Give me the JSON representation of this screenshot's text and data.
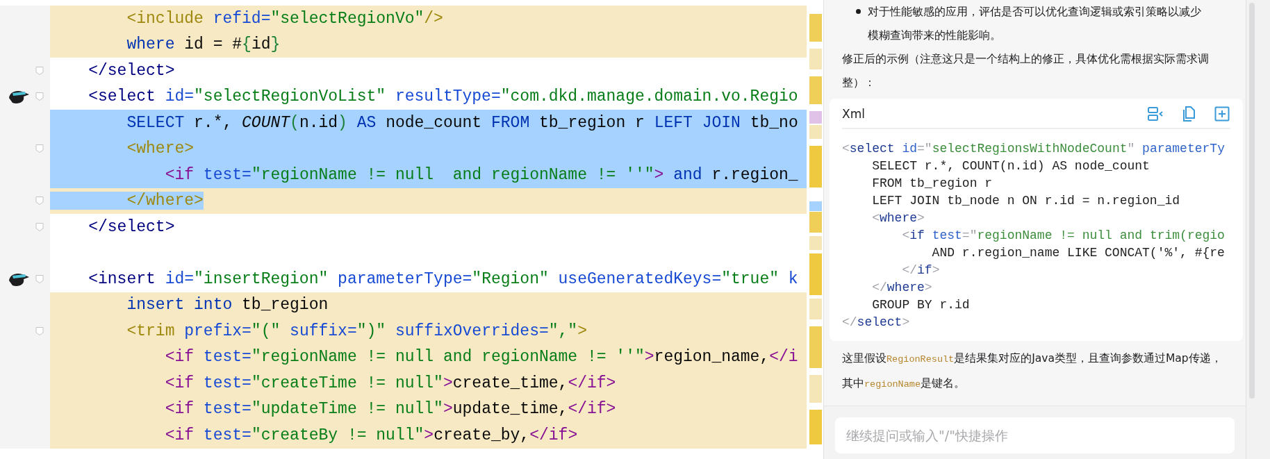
{
  "editor": {
    "lines": [
      {
        "changed": true,
        "selected": false,
        "avatar": false,
        "fold": false,
        "tokens": [
          {
            "kind": "tag-sql",
            "text": "        <include"
          },
          {
            "kind": "attr",
            "text": " refid="
          },
          {
            "kind": "str",
            "text": "\"selectRegionVo\""
          },
          {
            "kind": "tag-sql",
            "text": "/>"
          }
        ]
      },
      {
        "changed": true,
        "selected": false,
        "avatar": false,
        "fold": false,
        "tokens": [
          {
            "kind": "kw",
            "text": "        where"
          },
          {
            "kind": "text",
            "text": " id = #"
          },
          {
            "kind": "brace",
            "text": "{"
          },
          {
            "kind": "text",
            "text": "id"
          },
          {
            "kind": "brace",
            "text": "}"
          }
        ]
      },
      {
        "changed": false,
        "selected": false,
        "avatar": false,
        "fold": true,
        "tokens": [
          {
            "kind": "tag-stmt",
            "text": "    </select>"
          }
        ]
      },
      {
        "changed": false,
        "selected": false,
        "avatar": true,
        "fold": true,
        "tokens": [
          {
            "kind": "tag-stmt",
            "text": "    <select"
          },
          {
            "kind": "attr",
            "text": " id="
          },
          {
            "kind": "str",
            "text": "\"selectRegionVoList\""
          },
          {
            "kind": "attr",
            "text": " resultType="
          },
          {
            "kind": "str",
            "text": "\"com.dkd.manage.domain.vo.Regio"
          }
        ]
      },
      {
        "changed": false,
        "selected": true,
        "avatar": false,
        "fold": false,
        "tokens": [
          {
            "kind": "kw",
            "text": "        SELECT"
          },
          {
            "kind": "text",
            "text": " r.*, "
          },
          {
            "kind": "func",
            "text": "COUNT"
          },
          {
            "kind": "brace",
            "text": "("
          },
          {
            "kind": "text",
            "text": "n.id"
          },
          {
            "kind": "brace",
            "text": ")"
          },
          {
            "kind": "kw",
            "text": " AS"
          },
          {
            "kind": "text",
            "text": " node_count "
          },
          {
            "kind": "kw",
            "text": "FROM"
          },
          {
            "kind": "text",
            "text": " tb_region r "
          },
          {
            "kind": "kw",
            "text": "LEFT JOIN"
          },
          {
            "kind": "text",
            "text": " tb_no"
          }
        ]
      },
      {
        "changed": false,
        "selected": true,
        "avatar": false,
        "fold": true,
        "tokens": [
          {
            "kind": "tag-sql",
            "text": "        <where>"
          }
        ]
      },
      {
        "changed": false,
        "selected": true,
        "avatar": false,
        "fold": false,
        "tokens": [
          {
            "kind": "tag-if",
            "text": "            <if"
          },
          {
            "kind": "attr",
            "text": " test="
          },
          {
            "kind": "str",
            "text": "\"regionName != null  and regionName != ''\""
          },
          {
            "kind": "tag-if",
            "text": ">"
          },
          {
            "kind": "kw",
            "text": " and"
          },
          {
            "kind": "text",
            "text": " r.region_"
          }
        ]
      },
      {
        "changed": true,
        "selected": true,
        "avatar": false,
        "fold": true,
        "tokens": [
          {
            "kind": "tag-sql",
            "text": "        </where>"
          }
        ]
      },
      {
        "changed": false,
        "selected": false,
        "avatar": false,
        "fold": true,
        "tokens": [
          {
            "kind": "tag-stmt",
            "text": "    </select>"
          }
        ]
      },
      {
        "changed": false,
        "selected": false,
        "avatar": false,
        "fold": false
      },
      {
        "changed": false,
        "selected": false,
        "avatar": true,
        "fold": true,
        "tokens": [
          {
            "kind": "tag-stmt",
            "text": "    <insert"
          },
          {
            "kind": "attr",
            "text": " id="
          },
          {
            "kind": "str",
            "text": "\"insertRegion\""
          },
          {
            "kind": "attr",
            "text": " parameterType="
          },
          {
            "kind": "str",
            "text": "\"Region\""
          },
          {
            "kind": "attr",
            "text": " useGeneratedKeys="
          },
          {
            "kind": "str",
            "text": "\"true\""
          },
          {
            "kind": "attr",
            "text": " k"
          }
        ]
      },
      {
        "changed": true,
        "selected": false,
        "avatar": false,
        "fold": false,
        "tokens": [
          {
            "kind": "kw",
            "text": "        insert into"
          },
          {
            "kind": "text",
            "text": " tb_region"
          }
        ]
      },
      {
        "changed": true,
        "selected": false,
        "avatar": false,
        "fold": true,
        "tokens": [
          {
            "kind": "tag-sql",
            "text": "        <trim"
          },
          {
            "kind": "attr",
            "text": " prefix="
          },
          {
            "kind": "str",
            "text": "\"(\""
          },
          {
            "kind": "attr",
            "text": " suffix="
          },
          {
            "kind": "str",
            "text": "\")\""
          },
          {
            "kind": "attr",
            "text": " suffixOverrides="
          },
          {
            "kind": "str",
            "text": "\",\""
          },
          {
            "kind": "tag-sql",
            "text": ">"
          }
        ]
      },
      {
        "changed": true,
        "selected": false,
        "avatar": false,
        "fold": false,
        "tokens": [
          {
            "kind": "tag-if",
            "text": "            <if"
          },
          {
            "kind": "attr",
            "text": " test="
          },
          {
            "kind": "str",
            "text": "\"regionName != null and regionName != ''\""
          },
          {
            "kind": "tag-if",
            "text": ">"
          },
          {
            "kind": "text",
            "text": "region_name,"
          },
          {
            "kind": "tag-if",
            "text": "</i"
          }
        ]
      },
      {
        "changed": true,
        "selected": false,
        "avatar": false,
        "fold": false,
        "tokens": [
          {
            "kind": "tag-if",
            "text": "            <if"
          },
          {
            "kind": "attr",
            "text": " test="
          },
          {
            "kind": "str",
            "text": "\"createTime != null\""
          },
          {
            "kind": "tag-if",
            "text": ">"
          },
          {
            "kind": "text",
            "text": "create_time,"
          },
          {
            "kind": "tag-if",
            "text": "</if>"
          }
        ]
      },
      {
        "changed": true,
        "selected": false,
        "avatar": false,
        "fold": false,
        "tokens": [
          {
            "kind": "tag-if",
            "text": "            <if"
          },
          {
            "kind": "attr",
            "text": " test="
          },
          {
            "kind": "str",
            "text": "\"updateTime != null\""
          },
          {
            "kind": "tag-if",
            "text": ">"
          },
          {
            "kind": "text",
            "text": "update_time,"
          },
          {
            "kind": "tag-if",
            "text": "</if>"
          }
        ]
      },
      {
        "changed": true,
        "selected": false,
        "avatar": false,
        "fold": false,
        "tokens": [
          {
            "kind": "tag-if",
            "text": "            <if"
          },
          {
            "kind": "attr",
            "text": " test="
          },
          {
            "kind": "str",
            "text": "\"createBy != null\""
          },
          {
            "kind": "tag-if",
            "text": ">"
          },
          {
            "kind": "text",
            "text": "create_by,"
          },
          {
            "kind": "tag-if",
            "text": "</if>"
          }
        ]
      }
    ]
  },
  "assistant": {
    "bullet_text": "对于性能敏感的应用，评估是否可以优化查询逻辑或索引策略以减少模糊查询带来的性能影响。",
    "intro": "修正后的示例（注意这只是一个结构上的修正，具体优化需根据实际需求调整）：",
    "code_block": {
      "language": "Xml",
      "lines": [
        [
          {
            "kind": "punct",
            "text": "<"
          },
          {
            "kind": "tag",
            "text": "select"
          },
          {
            "kind": "attr",
            "text": " id"
          },
          {
            "kind": "punct",
            "text": "=\""
          },
          {
            "kind": "str",
            "text": "selectRegionsWithNodeCount"
          },
          {
            "kind": "punct",
            "text": "\""
          },
          {
            "kind": "attr",
            "text": " parameterTy"
          }
        ],
        [
          {
            "kind": "text",
            "text": "    SELECT r.*, COUNT(n.id) AS node_count"
          }
        ],
        [
          {
            "kind": "text",
            "text": "    FROM tb_region r"
          }
        ],
        [
          {
            "kind": "text",
            "text": "    LEFT JOIN tb_node n ON r.id = n.region_id"
          }
        ],
        [
          {
            "kind": "punct",
            "text": "    <"
          },
          {
            "kind": "tag",
            "text": "where"
          },
          {
            "kind": "punct",
            "text": ">"
          }
        ],
        [
          {
            "kind": "punct",
            "text": "        <"
          },
          {
            "kind": "tag",
            "text": "if"
          },
          {
            "kind": "attr",
            "text": " test"
          },
          {
            "kind": "punct",
            "text": "=\""
          },
          {
            "kind": "str",
            "text": "regionName != null and trim(regio"
          }
        ],
        [
          {
            "kind": "text",
            "text": "            AND r.region_name LIKE CONCAT('%', #{re"
          }
        ],
        [
          {
            "kind": "punct",
            "text": "        </"
          },
          {
            "kind": "tag",
            "text": "if"
          },
          {
            "kind": "punct",
            "text": ">"
          }
        ],
        [
          {
            "kind": "punct",
            "text": "    </"
          },
          {
            "kind": "tag",
            "text": "where"
          },
          {
            "kind": "punct",
            "text": ">"
          }
        ],
        [
          {
            "kind": "text",
            "text": "    GROUP BY r.id"
          }
        ],
        [
          {
            "kind": "punct",
            "text": "</"
          },
          {
            "kind": "tag",
            "text": "select"
          },
          {
            "kind": "punct",
            "text": ">"
          }
        ]
      ]
    },
    "note": [
      {
        "kind": "text",
        "text": "这里假设"
      },
      {
        "kind": "code",
        "text": "RegionResult"
      },
      {
        "kind": "text",
        "text": "是结果集对应的Java类型，且查询参数通过Map传递，其中"
      },
      {
        "kind": "code",
        "text": "regionName"
      },
      {
        "kind": "text",
        "text": "是键名。"
      }
    ],
    "input": {
      "placeholder": "继续提问或输入\"/\"快捷操作"
    }
  }
}
